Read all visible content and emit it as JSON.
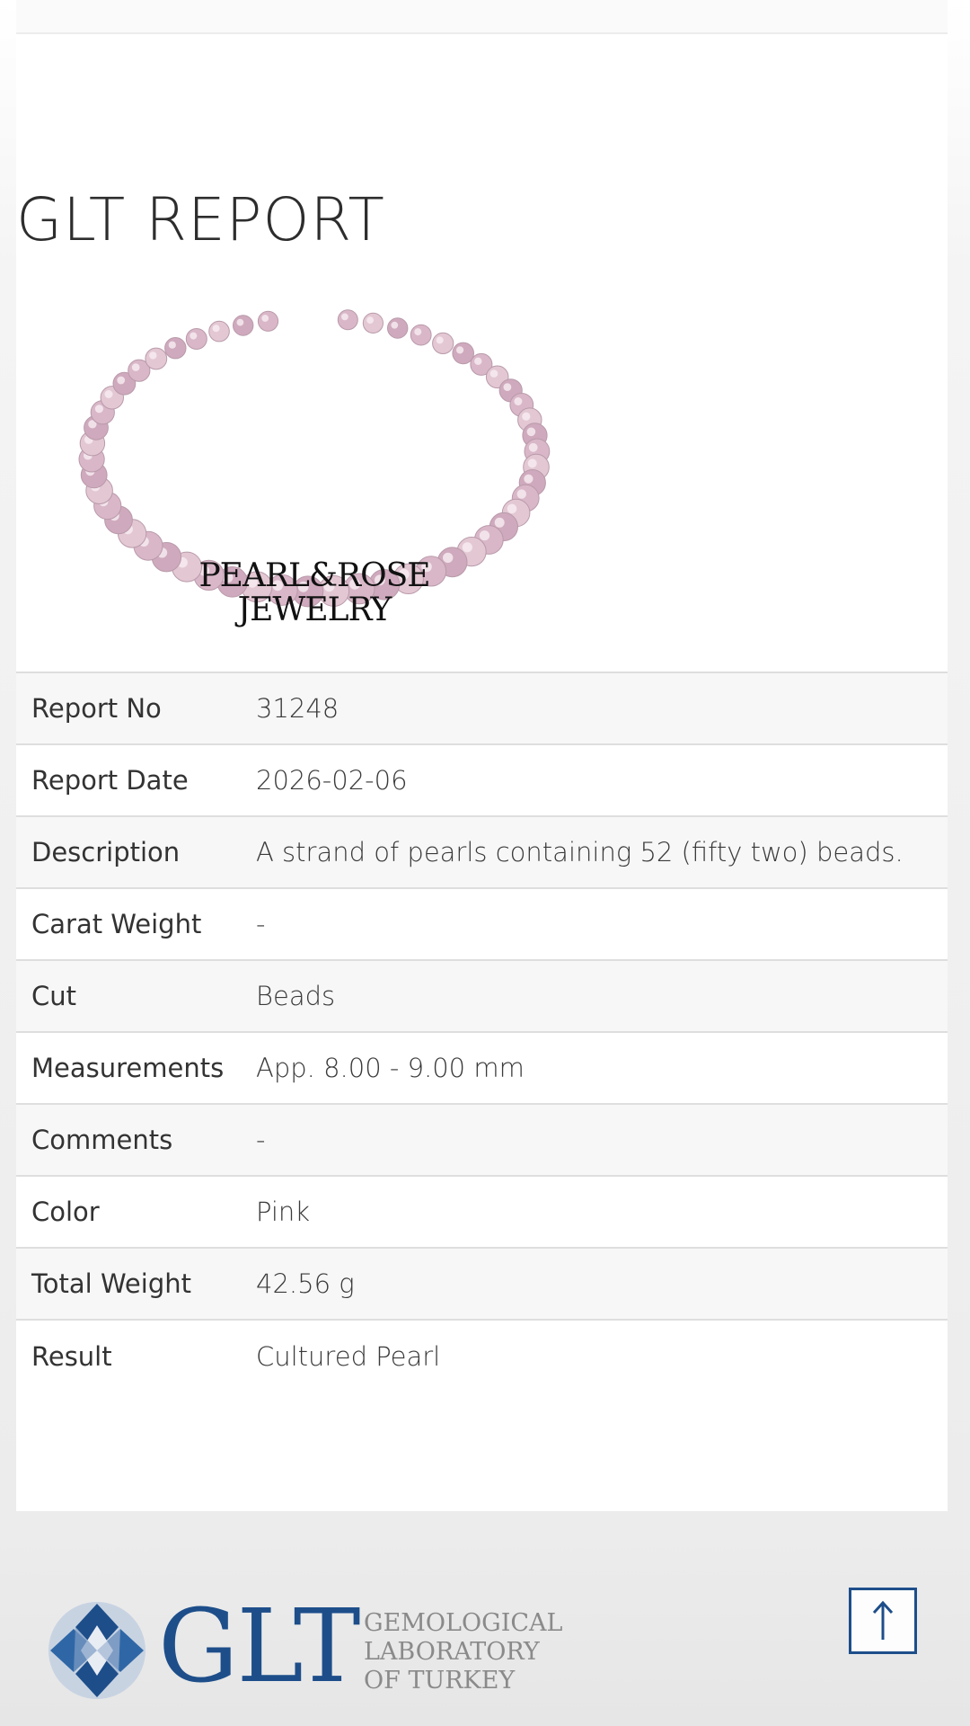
{
  "page": {
    "title": "GLT REPORT"
  },
  "brand": {
    "line1": "PEARL&ROSE",
    "line2": "JEWELRY"
  },
  "report_rows": [
    {
      "label": "Report No",
      "value": "31248"
    },
    {
      "label": "Report Date",
      "value": "2026-02-06"
    },
    {
      "label": "Description",
      "value": "A strand of pearls containing 52 (fifty two) beads."
    },
    {
      "label": "Carat Weight",
      "value": "-"
    },
    {
      "label": "Cut",
      "value": "Beads"
    },
    {
      "label": "Measurements",
      "value": "App. 8.00 - 9.00 mm"
    },
    {
      "label": "Comments",
      "value": "-"
    },
    {
      "label": "Color",
      "value": "Pink"
    },
    {
      "label": "Total Weight",
      "value": "42.56 g"
    },
    {
      "label": "Result",
      "value": "Cultured Pearl"
    }
  ],
  "footer": {
    "logo_word": "GLT",
    "logo_sub": [
      "GEMOLOGICAL",
      "LABORATORY",
      "OF TURKEY"
    ]
  },
  "icons": {
    "back_to_top": "arrow-up-icon",
    "logo_gem": "gem-icon"
  },
  "colors": {
    "brand_blue": "#1d4e8a",
    "row_alt": "#f7f7f7"
  }
}
